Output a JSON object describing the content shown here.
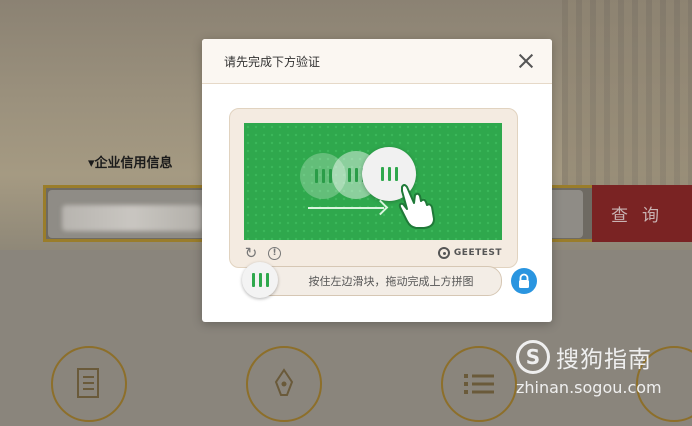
{
  "background": {
    "section_label": "▾企业信用信息",
    "search_button": "查询"
  },
  "watermark": {
    "brand": "搜狗指南",
    "url": "zhinan.sogou.com",
    "logo_letter": "S"
  },
  "modal": {
    "title": "请先完成下方验证",
    "close_icon": "close-icon"
  },
  "captcha": {
    "provider": "GEETEST",
    "slider_hint": "按住左边滑块，拖动完成上方拼图",
    "icons": [
      "refresh-icon",
      "info-icon",
      "lock-icon",
      "hand-pointer-icon"
    ],
    "colors": {
      "puzzle_green": "#2fa84d",
      "lock_blue": "#2a95e0"
    }
  }
}
